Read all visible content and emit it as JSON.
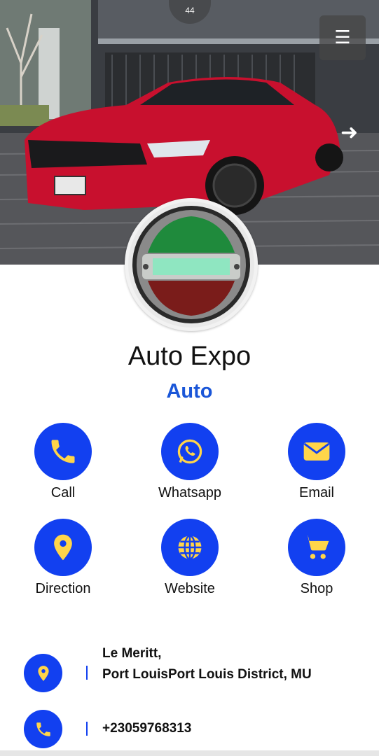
{
  "hero": {
    "counter": "44",
    "menu_icon": "hamburger-icon",
    "next_icon": "arrow-right-icon",
    "photo": "red sports car"
  },
  "profile": {
    "title": "Auto Expo",
    "category": "Auto"
  },
  "colors": {
    "accent": "#1240f0",
    "icon_yellow": "#ffd54a",
    "category_blue": "#1a56d8"
  },
  "actions": [
    {
      "label": "Call",
      "icon": "phone-icon"
    },
    {
      "label": "Whatsapp",
      "icon": "whatsapp-icon"
    },
    {
      "label": "Email",
      "icon": "envelope-icon"
    },
    {
      "label": "Direction",
      "icon": "map-pin-icon"
    },
    {
      "label": "Website",
      "icon": "globe-icon"
    },
    {
      "label": "Shop",
      "icon": "cart-icon"
    }
  ],
  "contact": {
    "address_line1": "Le Meritt,",
    "address_line2": "Port LouisPort Louis District, MU",
    "phone": "+23059768313"
  }
}
